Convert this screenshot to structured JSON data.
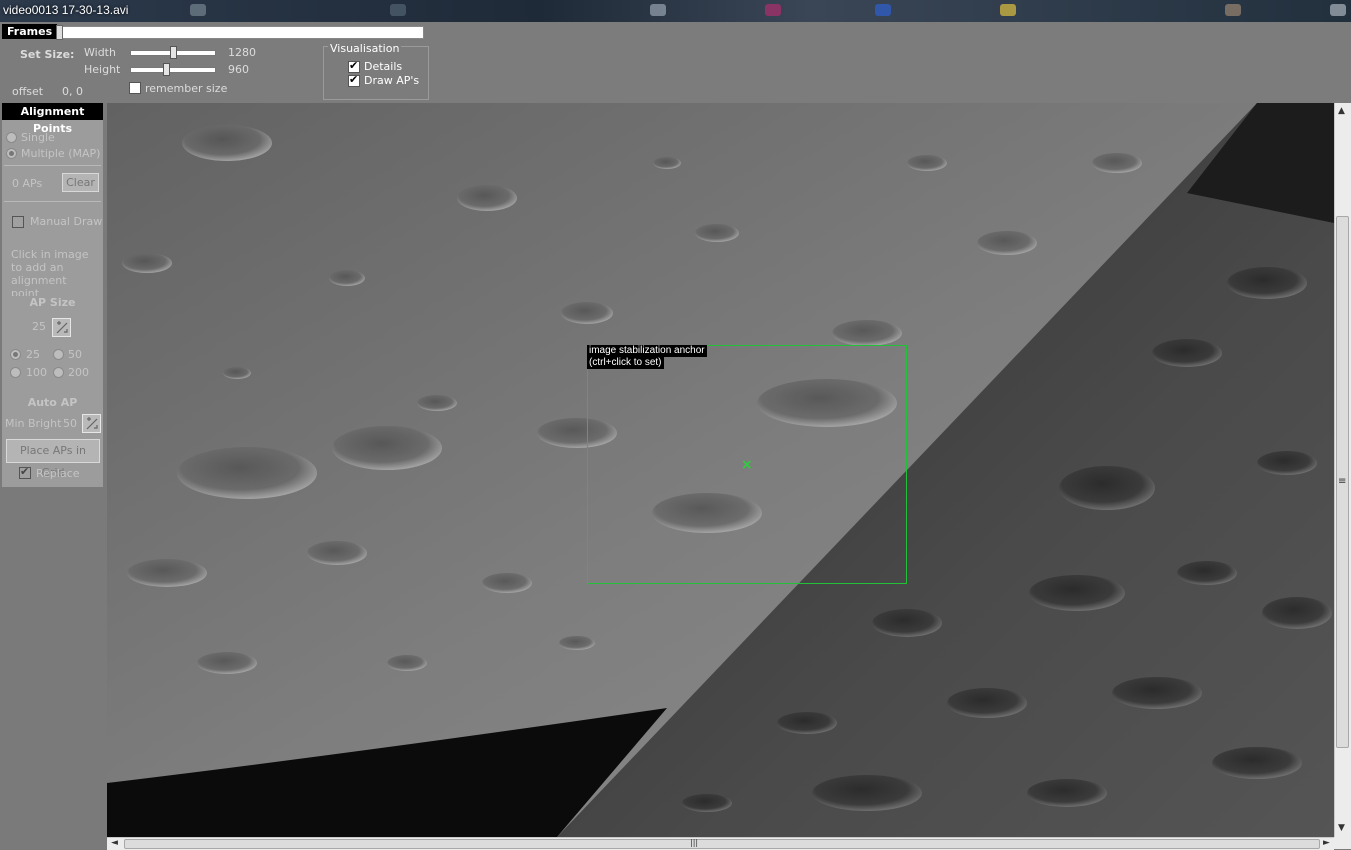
{
  "window": {
    "title": "video0013 17-30-13.avi"
  },
  "frames": {
    "label": "Frames"
  },
  "set_size": {
    "label": "Set Size:",
    "width_label": "Width",
    "width_value": "1280",
    "height_label": "Height",
    "height_value": "960",
    "offset_label": "offset",
    "offset_value": "0, 0",
    "remember_label": "remember size",
    "remember_checked": false
  },
  "visualisation": {
    "title": "Visualisation",
    "details_label": "Details",
    "details_checked": true,
    "draw_aps_label": "Draw AP's",
    "draw_aps_checked": true
  },
  "alignment_points": {
    "title": "Alignment Points",
    "mode_single": "Single",
    "mode_multiple": "Multiple (MAP)",
    "mode_selected": "Multiple (MAP)",
    "ap_count": "0 APs",
    "clear_label": "Clear",
    "manual_draw_label": "Manual Draw",
    "manual_draw_checked": false,
    "hint": "Click in image to add an alignment point",
    "ap_size_header": "AP Size",
    "ap_size_value": "25",
    "size_options": [
      "25",
      "50",
      "100",
      "200"
    ],
    "size_selected": "25",
    "auto_ap_header": "Auto AP",
    "min_bright_label": "Min Bright",
    "min_bright_value": "50",
    "place_grid_label": "Place APs in Grid",
    "replace_label": "Replace",
    "replace_checked": true
  },
  "viewer": {
    "anchor_line1": "image stabilization anchor",
    "anchor_line2": "(ctrl+click to set)",
    "anchor_marker": "×",
    "anchor_color": "#21c238"
  },
  "scrollbars": {
    "up": "▲",
    "down": "▼",
    "left": "◄",
    "right": "►",
    "grip_v": "≡",
    "grip_h": "|||"
  }
}
